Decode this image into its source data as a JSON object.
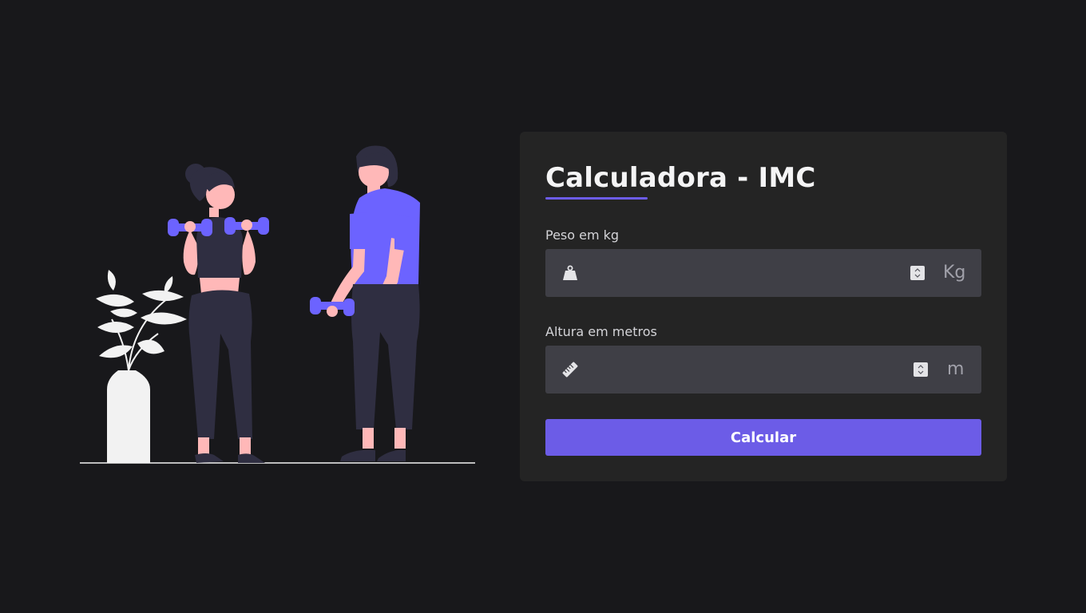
{
  "illustration": {
    "icon": "fitness-illustration",
    "accent_color": "#6c63ff",
    "dark_color": "#2f2e41",
    "skin_color": "#ffb8b8",
    "plant_color": "#f2f2f2"
  },
  "card": {
    "title": "Calculadora - IMC",
    "accent_color": "#6c5ce7"
  },
  "form": {
    "peso": {
      "label": "Peso em kg",
      "value": "",
      "placeholder": "",
      "unit": "Kg",
      "icon": "weight-icon"
    },
    "altura": {
      "label": "Altura em metros",
      "value": "",
      "placeholder": "",
      "unit": "m",
      "icon": "ruler-icon"
    },
    "submit_label": "Calcular"
  }
}
